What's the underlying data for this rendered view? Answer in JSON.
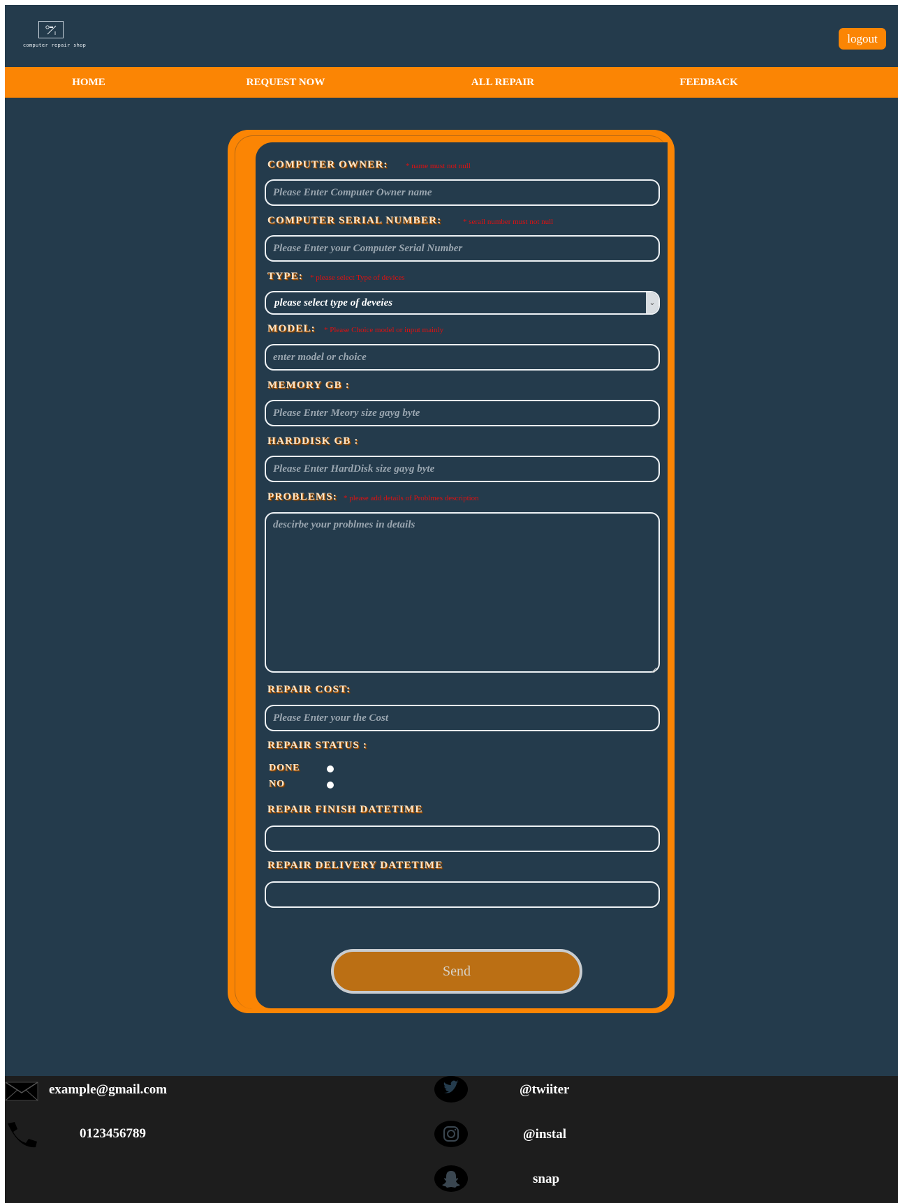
{
  "header": {
    "logo_text": "computer repair shop",
    "logout_label": "logout"
  },
  "nav": {
    "items": [
      {
        "label": "HOME"
      },
      {
        "label": "REQUEST NOW"
      },
      {
        "label": "ALL REPAIR"
      },
      {
        "label": "FEEDBACK"
      }
    ]
  },
  "form": {
    "owner": {
      "label": "COMPUTER OWNER:",
      "required_note": "* name must not null",
      "placeholder": "Please Enter Computer Owner name"
    },
    "serial": {
      "label": "COMPUTER SERIAL NUMBER:",
      "required_note": "* serail number must not null",
      "placeholder": "Please Enter your Computer Serial Number"
    },
    "type": {
      "label": "TYPE:",
      "required_note": "* please select Type of devices",
      "selected": "please select type of deveies"
    },
    "model": {
      "label": "MODEL:",
      "required_note": "* Please Choice model or input mainly",
      "placeholder": "enter model or choice"
    },
    "memory": {
      "label": "MEMORY GB :",
      "placeholder": "Please Enter Meory size gayg byte"
    },
    "harddisk": {
      "label": "HARDDISK GB :",
      "placeholder": "Please Enter HardDisk size gayg byte"
    },
    "problems": {
      "label": "PROBLEMS:",
      "required_note": "* please add details of Problmes description",
      "placeholder": "descirbe your problmes in details"
    },
    "cost": {
      "label": "REPAIR COST:",
      "placeholder": "Please Enter your the Cost"
    },
    "status": {
      "label": "REPAIR STATUS :",
      "options": [
        {
          "label": "DONE"
        },
        {
          "label": "NO"
        }
      ]
    },
    "finish": {
      "label": "REPAIR FINISH DATETIME",
      "value": ""
    },
    "delivery": {
      "label": "REPAIR DELIVERY DATETIME",
      "value": ""
    },
    "send_label": "Send"
  },
  "footer": {
    "email": "example@gmail.com",
    "phone": "0123456789",
    "twitter": "@twiiter",
    "instagram": "@instal",
    "snapchat": "snap"
  },
  "colors": {
    "background": "#243b4c",
    "accent": "#fb8504",
    "footer": "#1d1d1d",
    "required": "#e01010"
  }
}
